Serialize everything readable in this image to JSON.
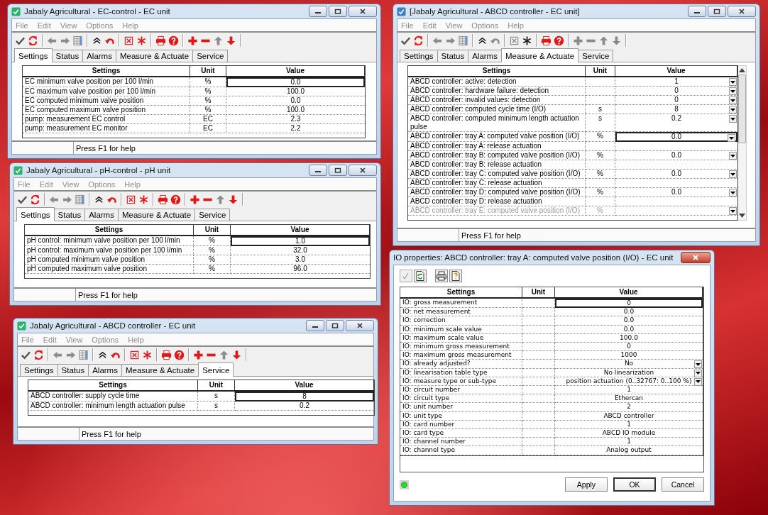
{
  "windows": [
    {
      "kind": "editor",
      "title": "Jabaly Agricultural - EC-control - EC unit",
      "edit_tools_enabled": true,
      "menu": [
        "File",
        "Edit",
        "View",
        "Options",
        "Help"
      ],
      "tabs": [
        {
          "label": "Settings",
          "selected": true
        },
        {
          "label": "Status",
          "selected": false
        },
        {
          "label": "Alarms",
          "selected": false
        },
        {
          "label": "Measure & Actuate",
          "selected": false
        },
        {
          "label": "Service",
          "selected": false
        }
      ],
      "columns": [
        "Settings",
        "Unit",
        "Value"
      ],
      "rows": [
        {
          "setting": "EC minimum valve position per 100 l/min",
          "unit": "%",
          "value": "0.0",
          "focused": true
        },
        {
          "setting": "EC maximum valve position per 100 l/min",
          "unit": "%",
          "value": "100.0",
          "focused": false
        },
        {
          "setting": "EC computed minimum valve position",
          "unit": "%",
          "value": "0.0",
          "focused": false
        },
        {
          "setting": "EC computed maximum valve position",
          "unit": "%",
          "value": "100.0",
          "focused": false
        },
        {
          "setting": "pump: measurement EC control",
          "unit": "EC",
          "value": "2.3",
          "focused": false
        },
        {
          "setting": "pump: measurement EC monitor",
          "unit": "EC",
          "value": "2.2",
          "focused": false
        }
      ],
      "status": "Press F1 for help"
    },
    {
      "kind": "editor",
      "title": "Jabaly Agricultural - pH-control - pH unit",
      "edit_tools_enabled": true,
      "menu": [
        "File",
        "Edit",
        "View",
        "Options",
        "Help"
      ],
      "tabs": [
        {
          "label": "Settings",
          "selected": true
        },
        {
          "label": "Status",
          "selected": false
        },
        {
          "label": "Alarms",
          "selected": false
        },
        {
          "label": "Measure & Actuate",
          "selected": false
        },
        {
          "label": "Service",
          "selected": false
        }
      ],
      "columns": [
        "Settings",
        "Unit",
        "Value"
      ],
      "rows": [
        {
          "setting": "pH control: minimum valve position per 100 l/min",
          "unit": "%",
          "value": "1.0",
          "focused": true
        },
        {
          "setting": "pH control: maximum valve position per 100 l/min",
          "unit": "%",
          "value": "32.0",
          "focused": false
        },
        {
          "setting": "pH computed minimum valve position",
          "unit": "%",
          "value": "3.0",
          "focused": false
        },
        {
          "setting": "pH computed maximum valve position",
          "unit": "%",
          "value": "96.0",
          "focused": false
        }
      ],
      "status": "Press F1 for help"
    },
    {
      "kind": "editor",
      "title": "Jabaly Agricultural - ABCD controller - EC unit",
      "edit_tools_enabled": true,
      "menu": [
        "File",
        "Edit",
        "View",
        "Options",
        "Help"
      ],
      "tabs": [
        {
          "label": "Settings",
          "selected": false
        },
        {
          "label": "Status",
          "selected": false
        },
        {
          "label": "Alarms",
          "selected": false
        },
        {
          "label": "Measure & Actuate",
          "selected": false
        },
        {
          "label": "Service",
          "selected": true
        }
      ],
      "columns": [
        "Settings",
        "Unit",
        "Value"
      ],
      "rows": [
        {
          "setting": "ABCD controller: supply cycle time",
          "unit": "s",
          "value": "8",
          "focused": true
        },
        {
          "setting": "ABCD controller: minimum length actuation pulse",
          "unit": "s",
          "value": "0.2",
          "focused": false
        }
      ],
      "status": "Press F1 for help"
    },
    {
      "kind": "editor",
      "title": "[Jabaly Agricultural - ABCD controller - EC unit]",
      "edit_tools_enabled": false,
      "menu": [
        "File",
        "Edit",
        "View",
        "Options",
        "Help"
      ],
      "tabs": [
        {
          "label": "Settings",
          "selected": false
        },
        {
          "label": "Status",
          "selected": false
        },
        {
          "label": "Alarms",
          "selected": false
        },
        {
          "label": "Measure & Actuate",
          "selected": true
        },
        {
          "label": "Service",
          "selected": false
        }
      ],
      "columns": [
        "Settings",
        "Unit",
        "Value"
      ],
      "rows": [
        {
          "setting": "ABCD controller: active: detection",
          "value": "1",
          "focused": false,
          "dropdown": true,
          "disabled": false
        },
        {
          "setting": "ABCD controller: hardware failure: detection",
          "value": "0",
          "focused": false,
          "dropdown": true,
          "disabled": false
        },
        {
          "setting": "ABCD controller: invalid values: detection",
          "value": "0",
          "focused": false,
          "dropdown": true,
          "disabled": false
        },
        {
          "setting": "ABCD controller: computed cycle time (I/O)",
          "unit": "s",
          "value": "8",
          "focused": false,
          "dropdown": true,
          "disabled": false
        },
        {
          "setting": "ABCD controller: computed minimum length actuation pulse",
          "unit": "s",
          "value": "0.2",
          "focused": false,
          "dropdown": true,
          "disabled": false
        },
        {
          "setting": "ABCD controller: tray A: computed valve position (I/O)",
          "unit": "%",
          "value": "0.0",
          "focused": true,
          "dropdown": true,
          "disabled": false
        },
        {
          "setting": "ABCD controller: tray A: release actuation",
          "focused": false,
          "dropdown": false,
          "disabled": false
        },
        {
          "setting": "ABCD controller: tray B: computed valve position (I/O)",
          "unit": "%",
          "value": "0.0",
          "focused": false,
          "dropdown": true,
          "disabled": false
        },
        {
          "setting": "ABCD controller: tray B: release actuation",
          "focused": false,
          "dropdown": false,
          "disabled": false
        },
        {
          "setting": "ABCD controller: tray C: computed valve position (I/O)",
          "unit": "%",
          "value": "0.0",
          "focused": false,
          "dropdown": true,
          "disabled": false
        },
        {
          "setting": "ABCD controller: tray C: release actuation",
          "focused": false,
          "dropdown": false,
          "disabled": false
        },
        {
          "setting": "ABCD controller: tray D: computed valve position (I/O)",
          "unit": "%",
          "value": "0.0",
          "focused": false,
          "dropdown": true,
          "disabled": false
        },
        {
          "setting": "ABCD controller: tray D: release actuation",
          "focused": false,
          "dropdown": false,
          "disabled": false
        },
        {
          "setting": "ABCD controller: tray E: computed valve position (I/O)",
          "unit": "%",
          "focused": false,
          "dropdown": true,
          "disabled": true
        }
      ],
      "status": "Press F1 for help"
    },
    {
      "kind": "dialog",
      "title": "IO properties: ABCD controller: tray A: computed valve position (I/O) - EC unit",
      "columns": [
        "Settings",
        "Unit",
        "Value"
      ],
      "rows": [
        {
          "setting": "IO: gross measurement",
          "value": "0",
          "focused": true,
          "dropdown": false
        },
        {
          "setting": "IO: net measurement",
          "value": "0.0",
          "focused": false,
          "dropdown": false
        },
        {
          "setting": "IO: correction",
          "value": "0.0",
          "focused": false,
          "dropdown": false
        },
        {
          "setting": "IO: minimum scale value",
          "value": "0.0",
          "focused": false,
          "dropdown": false
        },
        {
          "setting": "IO: maximum scale value",
          "value": "100.0",
          "focused": false,
          "dropdown": false
        },
        {
          "setting": "IO: minimum gross measurement",
          "value": "0",
          "focused": false,
          "dropdown": false
        },
        {
          "setting": "IO: maximum gross measurement",
          "value": "1000",
          "focused": false,
          "dropdown": false
        },
        {
          "setting": "IO: already adjusted?",
          "value": "No",
          "focused": false,
          "dropdown": true
        },
        {
          "setting": "IO: linearisation table type",
          "value": "No linearization",
          "focused": false,
          "dropdown": true
        },
        {
          "setting": "IO: measure type or sub-type",
          "value": "position actuation (0..32767: 0..100 %)",
          "focused": false,
          "dropdown": true
        },
        {
          "setting": "IO: circuit number",
          "value": "1",
          "focused": false,
          "dropdown": false
        },
        {
          "setting": "IO: circuit type",
          "value": "Ethercan",
          "focused": false,
          "dropdown": false
        },
        {
          "setting": "IO: unit number",
          "value": "2",
          "focused": false,
          "dropdown": false
        },
        {
          "setting": "IO: unit type",
          "value": "ABCD controller",
          "focused": false,
          "dropdown": false
        },
        {
          "setting": "IO: card number",
          "value": "1",
          "focused": false,
          "dropdown": false
        },
        {
          "setting": "IO: card type",
          "value": "ABCD IO module",
          "focused": false,
          "dropdown": false
        },
        {
          "setting": "IO: channel number",
          "value": "1",
          "focused": false,
          "dropdown": false
        },
        {
          "setting": "IO: channel type",
          "value": "Analog output",
          "focused": false,
          "dropdown": false
        }
      ],
      "indicator": {
        "on": true
      },
      "buttons": [
        {
          "label": "Apply",
          "default": false
        },
        {
          "label": "OK",
          "default": true
        },
        {
          "label": "Cancel",
          "default": false
        }
      ]
    }
  ]
}
